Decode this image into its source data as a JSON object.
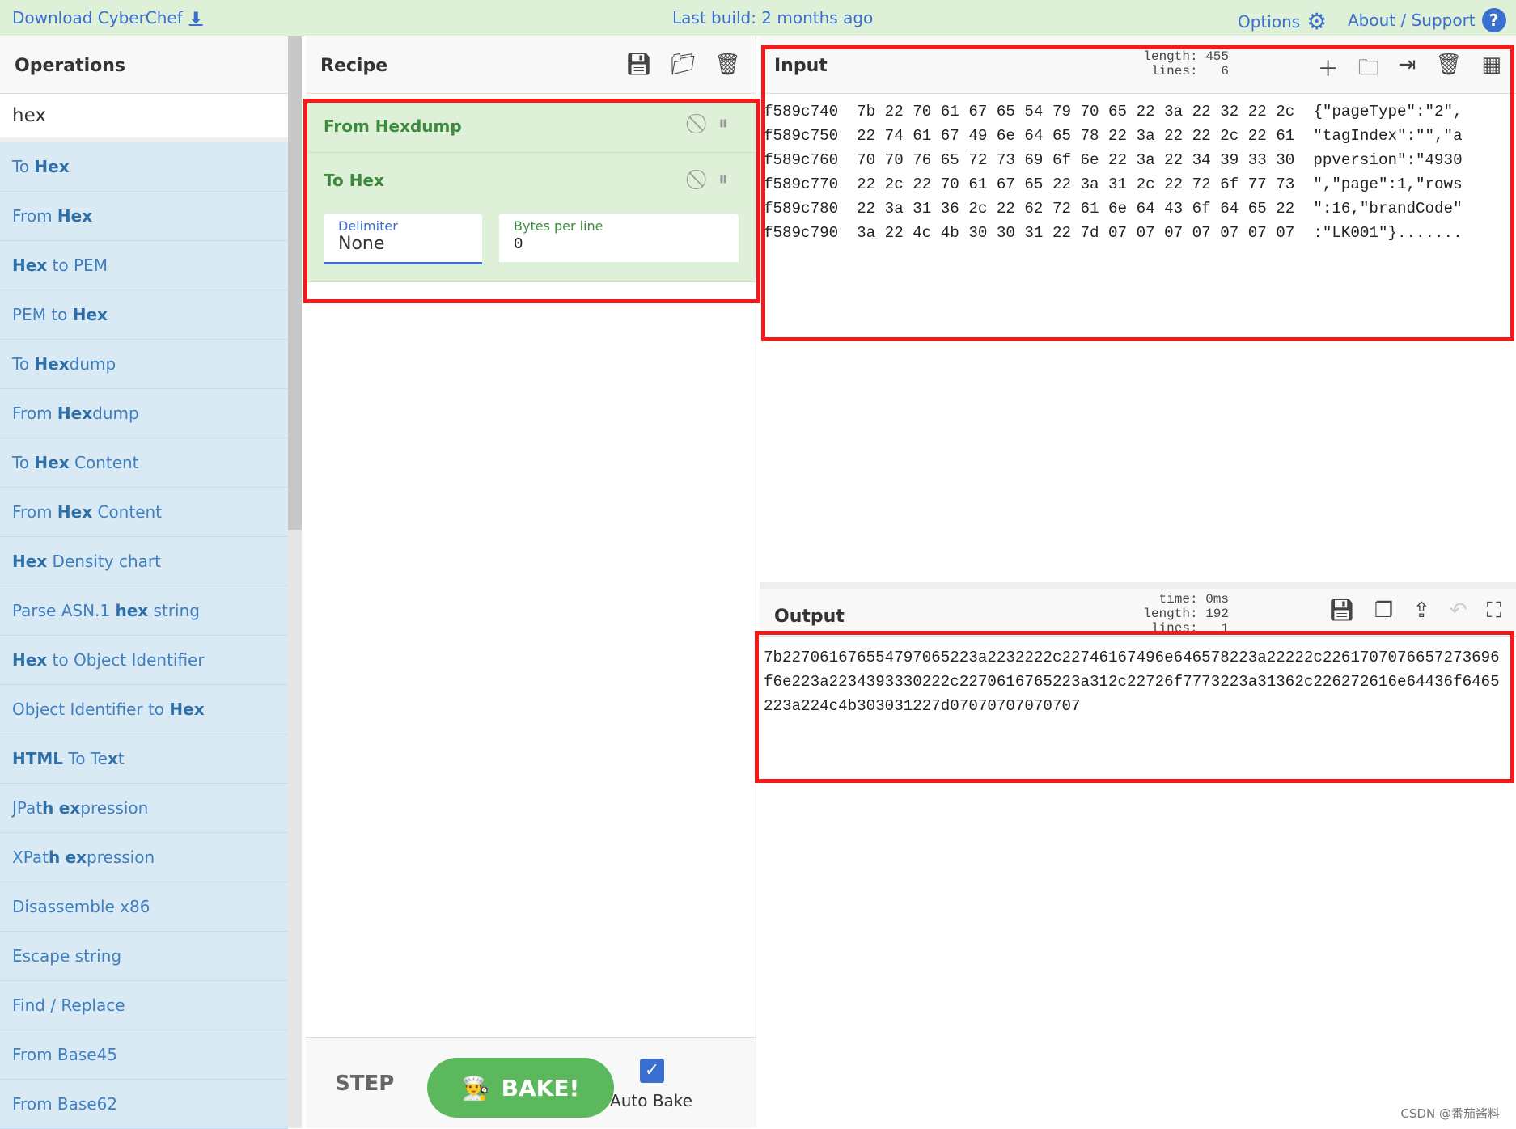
{
  "topbar": {
    "download": "Download CyberChef",
    "build": "Last build: 2 months ago",
    "options": "Options",
    "about": "About / Support"
  },
  "operations": {
    "title": "Operations",
    "search_value": "hex",
    "items": [
      [
        {
          "t": "To "
        },
        {
          "t": "Hex",
          "b": 1
        }
      ],
      [
        {
          "t": "From "
        },
        {
          "t": "Hex",
          "b": 1
        }
      ],
      [
        {
          "t": "Hex",
          "b": 1
        },
        {
          "t": " to PEM"
        }
      ],
      [
        {
          "t": "PEM to "
        },
        {
          "t": "Hex",
          "b": 1
        }
      ],
      [
        {
          "t": "To "
        },
        {
          "t": "Hex",
          "b": 1
        },
        {
          "t": "dump"
        }
      ],
      [
        {
          "t": "From "
        },
        {
          "t": "Hex",
          "b": 1
        },
        {
          "t": "dump"
        }
      ],
      [
        {
          "t": "To "
        },
        {
          "t": "Hex",
          "b": 1
        },
        {
          "t": " Content"
        }
      ],
      [
        {
          "t": "From "
        },
        {
          "t": "Hex",
          "b": 1
        },
        {
          "t": " Content"
        }
      ],
      [
        {
          "t": "Hex",
          "b": 1
        },
        {
          "t": " Density chart"
        }
      ],
      [
        {
          "t": "Parse ASN.1 "
        },
        {
          "t": "hex",
          "b": 1
        },
        {
          "t": " string"
        }
      ],
      [
        {
          "t": "Hex",
          "b": 1
        },
        {
          "t": " to Object Identifier"
        }
      ],
      [
        {
          "t": "Object Identifier to "
        },
        {
          "t": "Hex",
          "b": 1
        }
      ],
      [
        {
          "t": "HTML",
          "b": 1
        },
        {
          "t": " To Te"
        },
        {
          "t": "x",
          "b": 1
        },
        {
          "t": "t"
        }
      ],
      [
        {
          "t": "JPat"
        },
        {
          "t": "h",
          "b": 1
        },
        {
          "t": " "
        },
        {
          "t": "ex",
          "b": 1
        },
        {
          "t": "pression"
        }
      ],
      [
        {
          "t": "XPat"
        },
        {
          "t": "h",
          "b": 1
        },
        {
          "t": " "
        },
        {
          "t": "ex",
          "b": 1
        },
        {
          "t": "pression"
        }
      ],
      [
        {
          "t": "Disassemble x86"
        }
      ],
      [
        {
          "t": "Escape string"
        }
      ],
      [
        {
          "t": "Find / Replace"
        }
      ],
      [
        {
          "t": "From Base45"
        }
      ],
      [
        {
          "t": "From Base62"
        }
      ]
    ]
  },
  "recipe": {
    "title": "Recipe",
    "ops": [
      {
        "name": "From Hexdump"
      },
      {
        "name": "To Hex",
        "args": [
          {
            "label": "Delimiter",
            "value": "None"
          },
          {
            "label": "Bytes per line",
            "value": "0"
          }
        ]
      }
    ],
    "step": "STEP",
    "bake": "BAKE!",
    "auto_bake": "Auto Bake",
    "auto_bake_checked": true
  },
  "input": {
    "title": "Input",
    "length_label": "length:",
    "length": "455",
    "lines_label": "lines:",
    "lines": "6",
    "text": "f589c740  7b 22 70 61 67 65 54 79 70 65 22 3a 22 32 22 2c  {\"pageType\":\"2\",\nf589c750  22 74 61 67 49 6e 64 65 78 22 3a 22 22 2c 22 61  \"tagIndex\":\"\",\"a\nf589c760  70 70 76 65 72 73 69 6f 6e 22 3a 22 34 39 33 30  ppversion\":\"4930\nf589c770  22 2c 22 70 61 67 65 22 3a 31 2c 22 72 6f 77 73  \",\"page\":1,\"rows\nf589c780  22 3a 31 36 2c 22 62 72 61 6e 64 43 6f 64 65 22  \":16,\"brandCode\"\nf589c790  3a 22 4c 4b 30 30 31 22 7d 07 07 07 07 07 07 07  :\"LK001\"}......."
  },
  "output": {
    "title": "Output",
    "time_label": "time:",
    "time": "0ms",
    "length_label": "length:",
    "length": "192",
    "lines_label": "lines:",
    "lines": "1",
    "text": "7b227061676554797065223a2232222c22746167496e646578223a22222c2261707076657273696f6e223a2234393330222c2270616765223a312c22726f7773223a31362c226272616e64436f6465223a224c4b303031227d07070707070707"
  },
  "watermark": "CSDN @番茄酱料",
  "colors": {
    "topbar": "#dff0d8",
    "link": "#3a6fd0",
    "op_bg": "#d9eaf5",
    "recipe_op_bg": "#dff0d8",
    "bake": "#5cb85c",
    "highlight": "#f21a1a"
  }
}
